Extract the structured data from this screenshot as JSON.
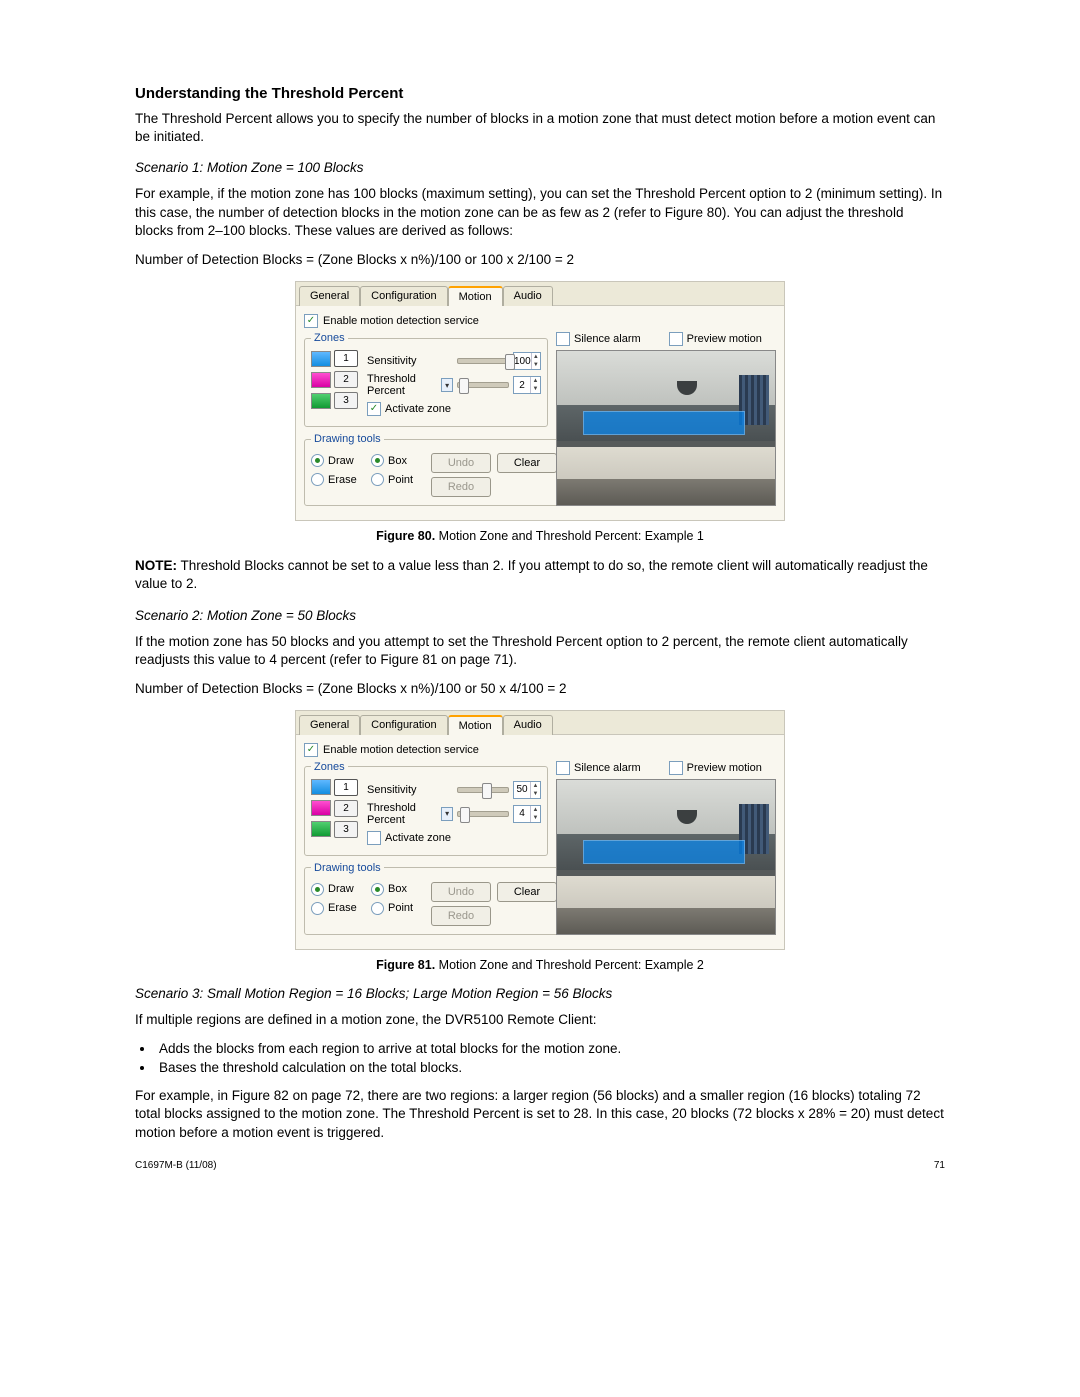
{
  "heading": "Understanding the Threshold Percent",
  "intro": "The Threshold Percent allows you to specify the number of blocks in a motion zone that must detect motion before a motion event can be initiated.",
  "scenario1": {
    "title": "Scenario 1: Motion Zone = 100 Blocks",
    "para": "For example, if the motion zone has 100 blocks (maximum setting), you can set the Threshold Percent option to 2 (minimum setting). In this case, the number of detection blocks in the motion zone can be as few as 2 (refer to Figure 80). You can adjust the threshold blocks from 2–100 blocks. These values are derived as follows:",
    "formula": "Number of Detection Blocks = (Zone Blocks x n%)/100 or 100 x 2/100 = 2"
  },
  "figure80_label": "Figure 80.",
  "figure80_caption": "  Motion Zone and Threshold Percent: Example 1",
  "note_label": "NOTE:",
  "note_text": "  Threshold Blocks cannot be set to a value less than 2.  If you attempt to do so, the remote client will automatically readjust the value to 2.",
  "scenario2": {
    "title": "Scenario 2: Motion Zone = 50 Blocks",
    "para": "If the motion zone has 50 blocks and you attempt to set the Threshold Percent option to 2 percent, the remote client automatically readjusts this value to 4 percent (refer to Figure 81 on page 71).",
    "formula": "Number of Detection Blocks = (Zone Blocks x n%)/100 or 50 x 4/100 = 2"
  },
  "figure81_label": "Figure 81.",
  "figure81_caption": "  Motion Zone and Threshold Percent: Example 2",
  "scenario3": {
    "title": "Scenario 3: Small Motion Region = 16 Blocks; Large Motion Region = 56 Blocks",
    "intro": "If multiple regions are defined in a motion zone, the DVR5100 Remote Client:",
    "bullet1": "Adds the blocks from each region to arrive at total blocks for the motion zone.",
    "bullet2": "Bases the threshold calculation on the total blocks.",
    "para": "For example, in Figure 82 on page 72, there are two regions: a larger region (56 blocks) and a smaller region (16 blocks) totaling 72 total blocks assigned to the motion zone. The Threshold Percent is set to 28. In this case, 20 blocks (72 blocks x 28% = 20) must detect motion before a motion event is triggered."
  },
  "footer_left": "C1697M-B (11/08)",
  "footer_right": "71",
  "ui": {
    "tabs": {
      "general": "General",
      "configuration": "Configuration",
      "motion": "Motion",
      "audio": "Audio"
    },
    "enable_label": "Enable motion detection service",
    "zones_legend": "Zones",
    "drawing_legend": "Drawing tools",
    "zone_nums": {
      "z1": "1",
      "z2": "2",
      "z3": "3"
    },
    "sensitivity": "Sensitivity",
    "threshold": "Threshold Percent",
    "activate": "Activate zone",
    "draw": "Draw",
    "erase": "Erase",
    "box": "Box",
    "point": "Point",
    "undo": "Undo",
    "redo": "Redo",
    "clear": "Clear",
    "silence": "Silence alarm",
    "preview": "Preview motion"
  },
  "example1": {
    "sensitivity": "100",
    "threshold": "2",
    "activate_checked": true,
    "sens_pos": "94%",
    "thr_pos": "2%"
  },
  "example2": {
    "sensitivity": "50",
    "threshold": "4",
    "activate_checked": false,
    "sens_pos": "48%",
    "thr_pos": "4%"
  }
}
